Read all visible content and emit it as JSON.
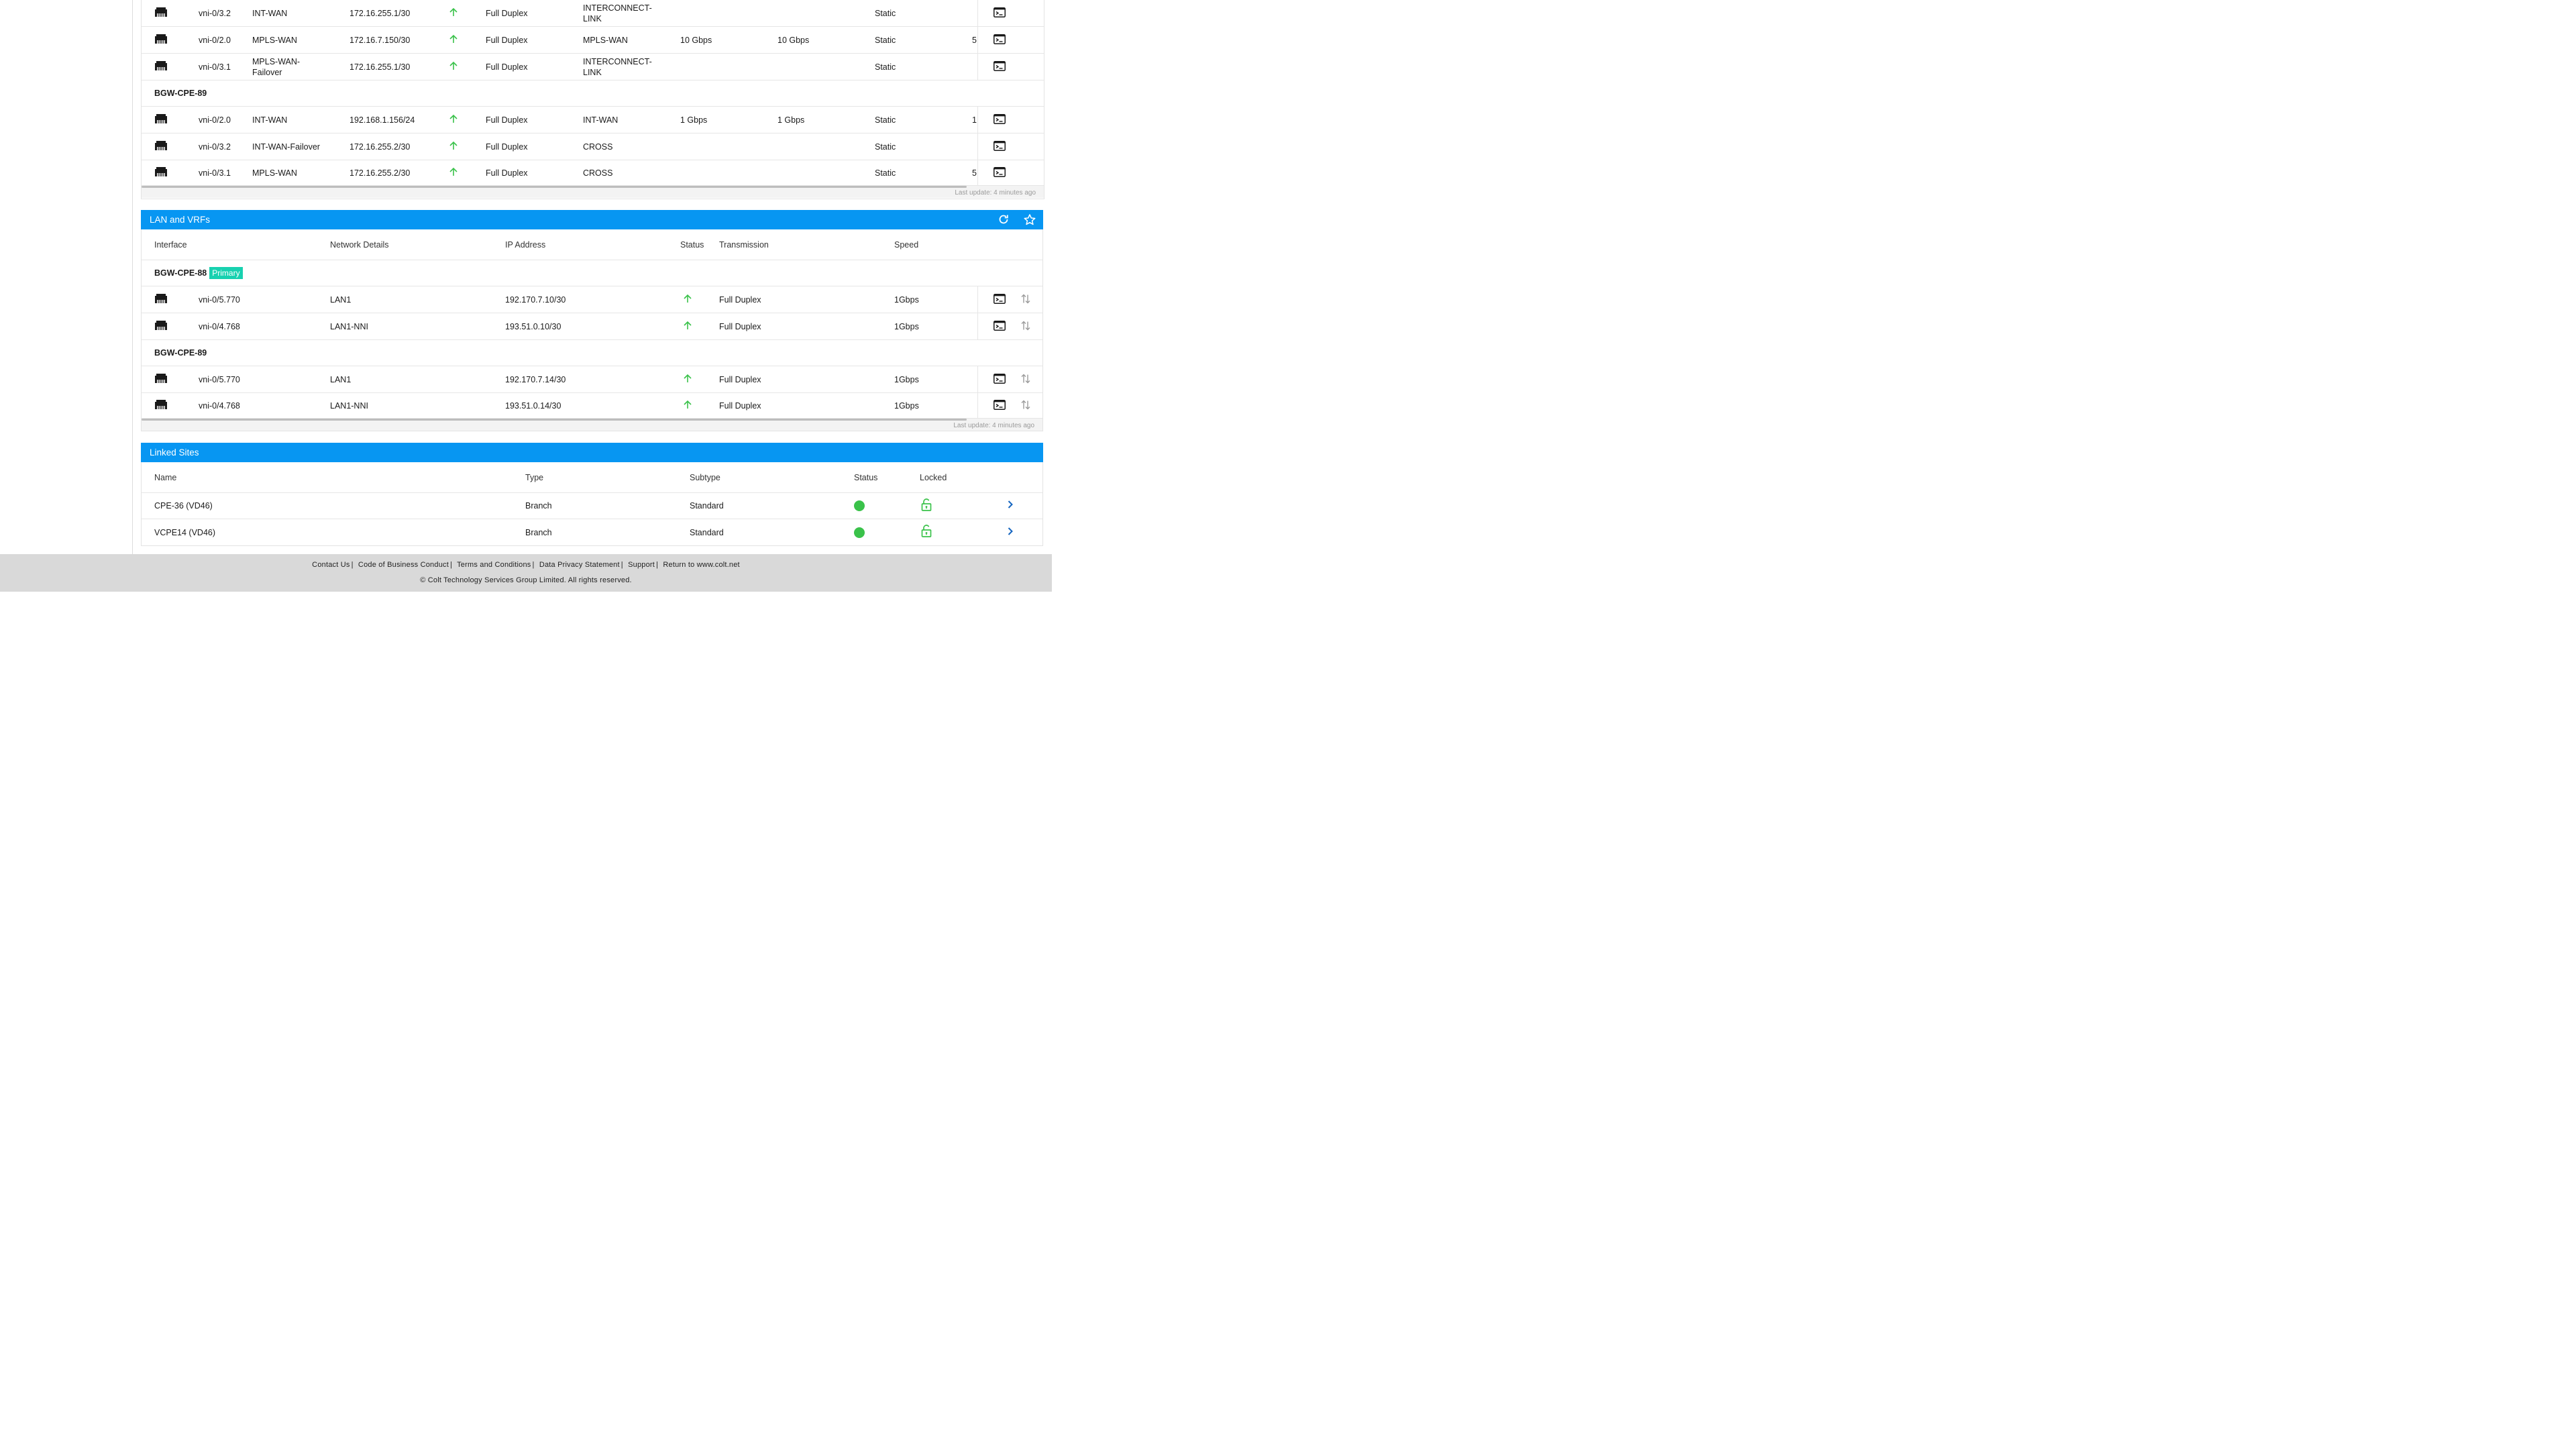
{
  "wan": {
    "rows_top": [
      {
        "interface": "vni-0/3.2",
        "network": "INT-WAN",
        "ip": "172.16.255.1/30",
        "transmission": "Full Duplex",
        "link": "INTERCONNECT-LINK",
        "up": "",
        "down": "",
        "mode": "Static",
        "extra": ""
      },
      {
        "interface": "vni-0/2.0",
        "network": "MPLS-WAN",
        "ip": "172.16.7.150/30",
        "transmission": "Full Duplex",
        "link": "MPLS-WAN",
        "up": "10 Gbps",
        "down": "10 Gbps",
        "mode": "Static",
        "extra": "5"
      },
      {
        "interface": "vni-0/3.1",
        "network": "MPLS-WAN-Failover",
        "ip": "172.16.255.1/30",
        "transmission": "Full Duplex",
        "link": "INTERCONNECT-LINK",
        "up": "",
        "down": "",
        "mode": "Static",
        "extra": ""
      }
    ],
    "group2_name": "BGW-CPE-89",
    "rows_g2": [
      {
        "interface": "vni-0/2.0",
        "network": "INT-WAN",
        "ip": "192.168.1.156/24",
        "transmission": "Full Duplex",
        "link": "INT-WAN",
        "up": "1 Gbps",
        "down": "1 Gbps",
        "mode": "Static",
        "extra": "1"
      },
      {
        "interface": "vni-0/3.2",
        "network": "INT-WAN-Failover",
        "ip": "172.16.255.2/30",
        "transmission": "Full Duplex",
        "link": "CROSS",
        "up": "",
        "down": "",
        "mode": "Static",
        "extra": ""
      },
      {
        "interface": "vni-0/3.1",
        "network": "MPLS-WAN",
        "ip": "172.16.255.2/30",
        "transmission": "Full Duplex",
        "link": "CROSS",
        "up": "",
        "down": "",
        "mode": "Static",
        "extra": "5"
      }
    ],
    "last_update": "Last update: 4 minutes ago"
  },
  "lan": {
    "title": "LAN and VRFs",
    "headers": {
      "interface": "Interface",
      "network": "Network Details",
      "ip": "IP Address",
      "status": "Status",
      "transmission": "Transmission",
      "speed": "Speed"
    },
    "group1_name": "BGW-CPE-88",
    "group1_badge": "Primary",
    "rows_g1": [
      {
        "interface": "vni-0/5.770",
        "network": "LAN1",
        "ip": "192.170.7.10/30",
        "transmission": "Full Duplex",
        "speed": "1Gbps"
      },
      {
        "interface": "vni-0/4.768",
        "network": "LAN1-NNI",
        "ip": "193.51.0.10/30",
        "transmission": "Full Duplex",
        "speed": "1Gbps"
      }
    ],
    "group2_name": "BGW-CPE-89",
    "rows_g2": [
      {
        "interface": "vni-0/5.770",
        "network": "LAN1",
        "ip": "192.170.7.14/30",
        "transmission": "Full Duplex",
        "speed": "1Gbps"
      },
      {
        "interface": "vni-0/4.768",
        "network": "LAN1-NNI",
        "ip": "193.51.0.14/30",
        "transmission": "Full Duplex",
        "speed": "1Gbps"
      }
    ],
    "last_update": "Last update: 4 minutes ago"
  },
  "linked": {
    "title": "Linked Sites",
    "headers": {
      "name": "Name",
      "type": "Type",
      "subtype": "Subtype",
      "status": "Status",
      "locked": "Locked"
    },
    "rows": [
      {
        "name": "CPE-36 (VD46)",
        "type": "Branch",
        "subtype": "Standard"
      },
      {
        "name": "VCPE14 (VD46)",
        "type": "Branch",
        "subtype": "Standard"
      }
    ]
  },
  "footer": {
    "links": [
      "Contact Us",
      "Code of Business Conduct",
      "Terms and Conditions",
      "Data Privacy Statement",
      "Support",
      "Return to www.colt.net"
    ],
    "separator": "|",
    "copyright": "© Colt Technology Services Group Limited. All rights reserved."
  },
  "colors": {
    "header_blue": "#0796f2",
    "status_green": "#3ac24a",
    "badge_teal": "#18d1b0",
    "link_blue": "#1565c0"
  },
  "icons": [
    "ethernet-port-icon",
    "arrow-up-icon",
    "terminal-icon",
    "swap-arrows-icon",
    "refresh-icon",
    "star-icon",
    "unlocked-padlock-icon",
    "chevron-right-icon"
  ]
}
